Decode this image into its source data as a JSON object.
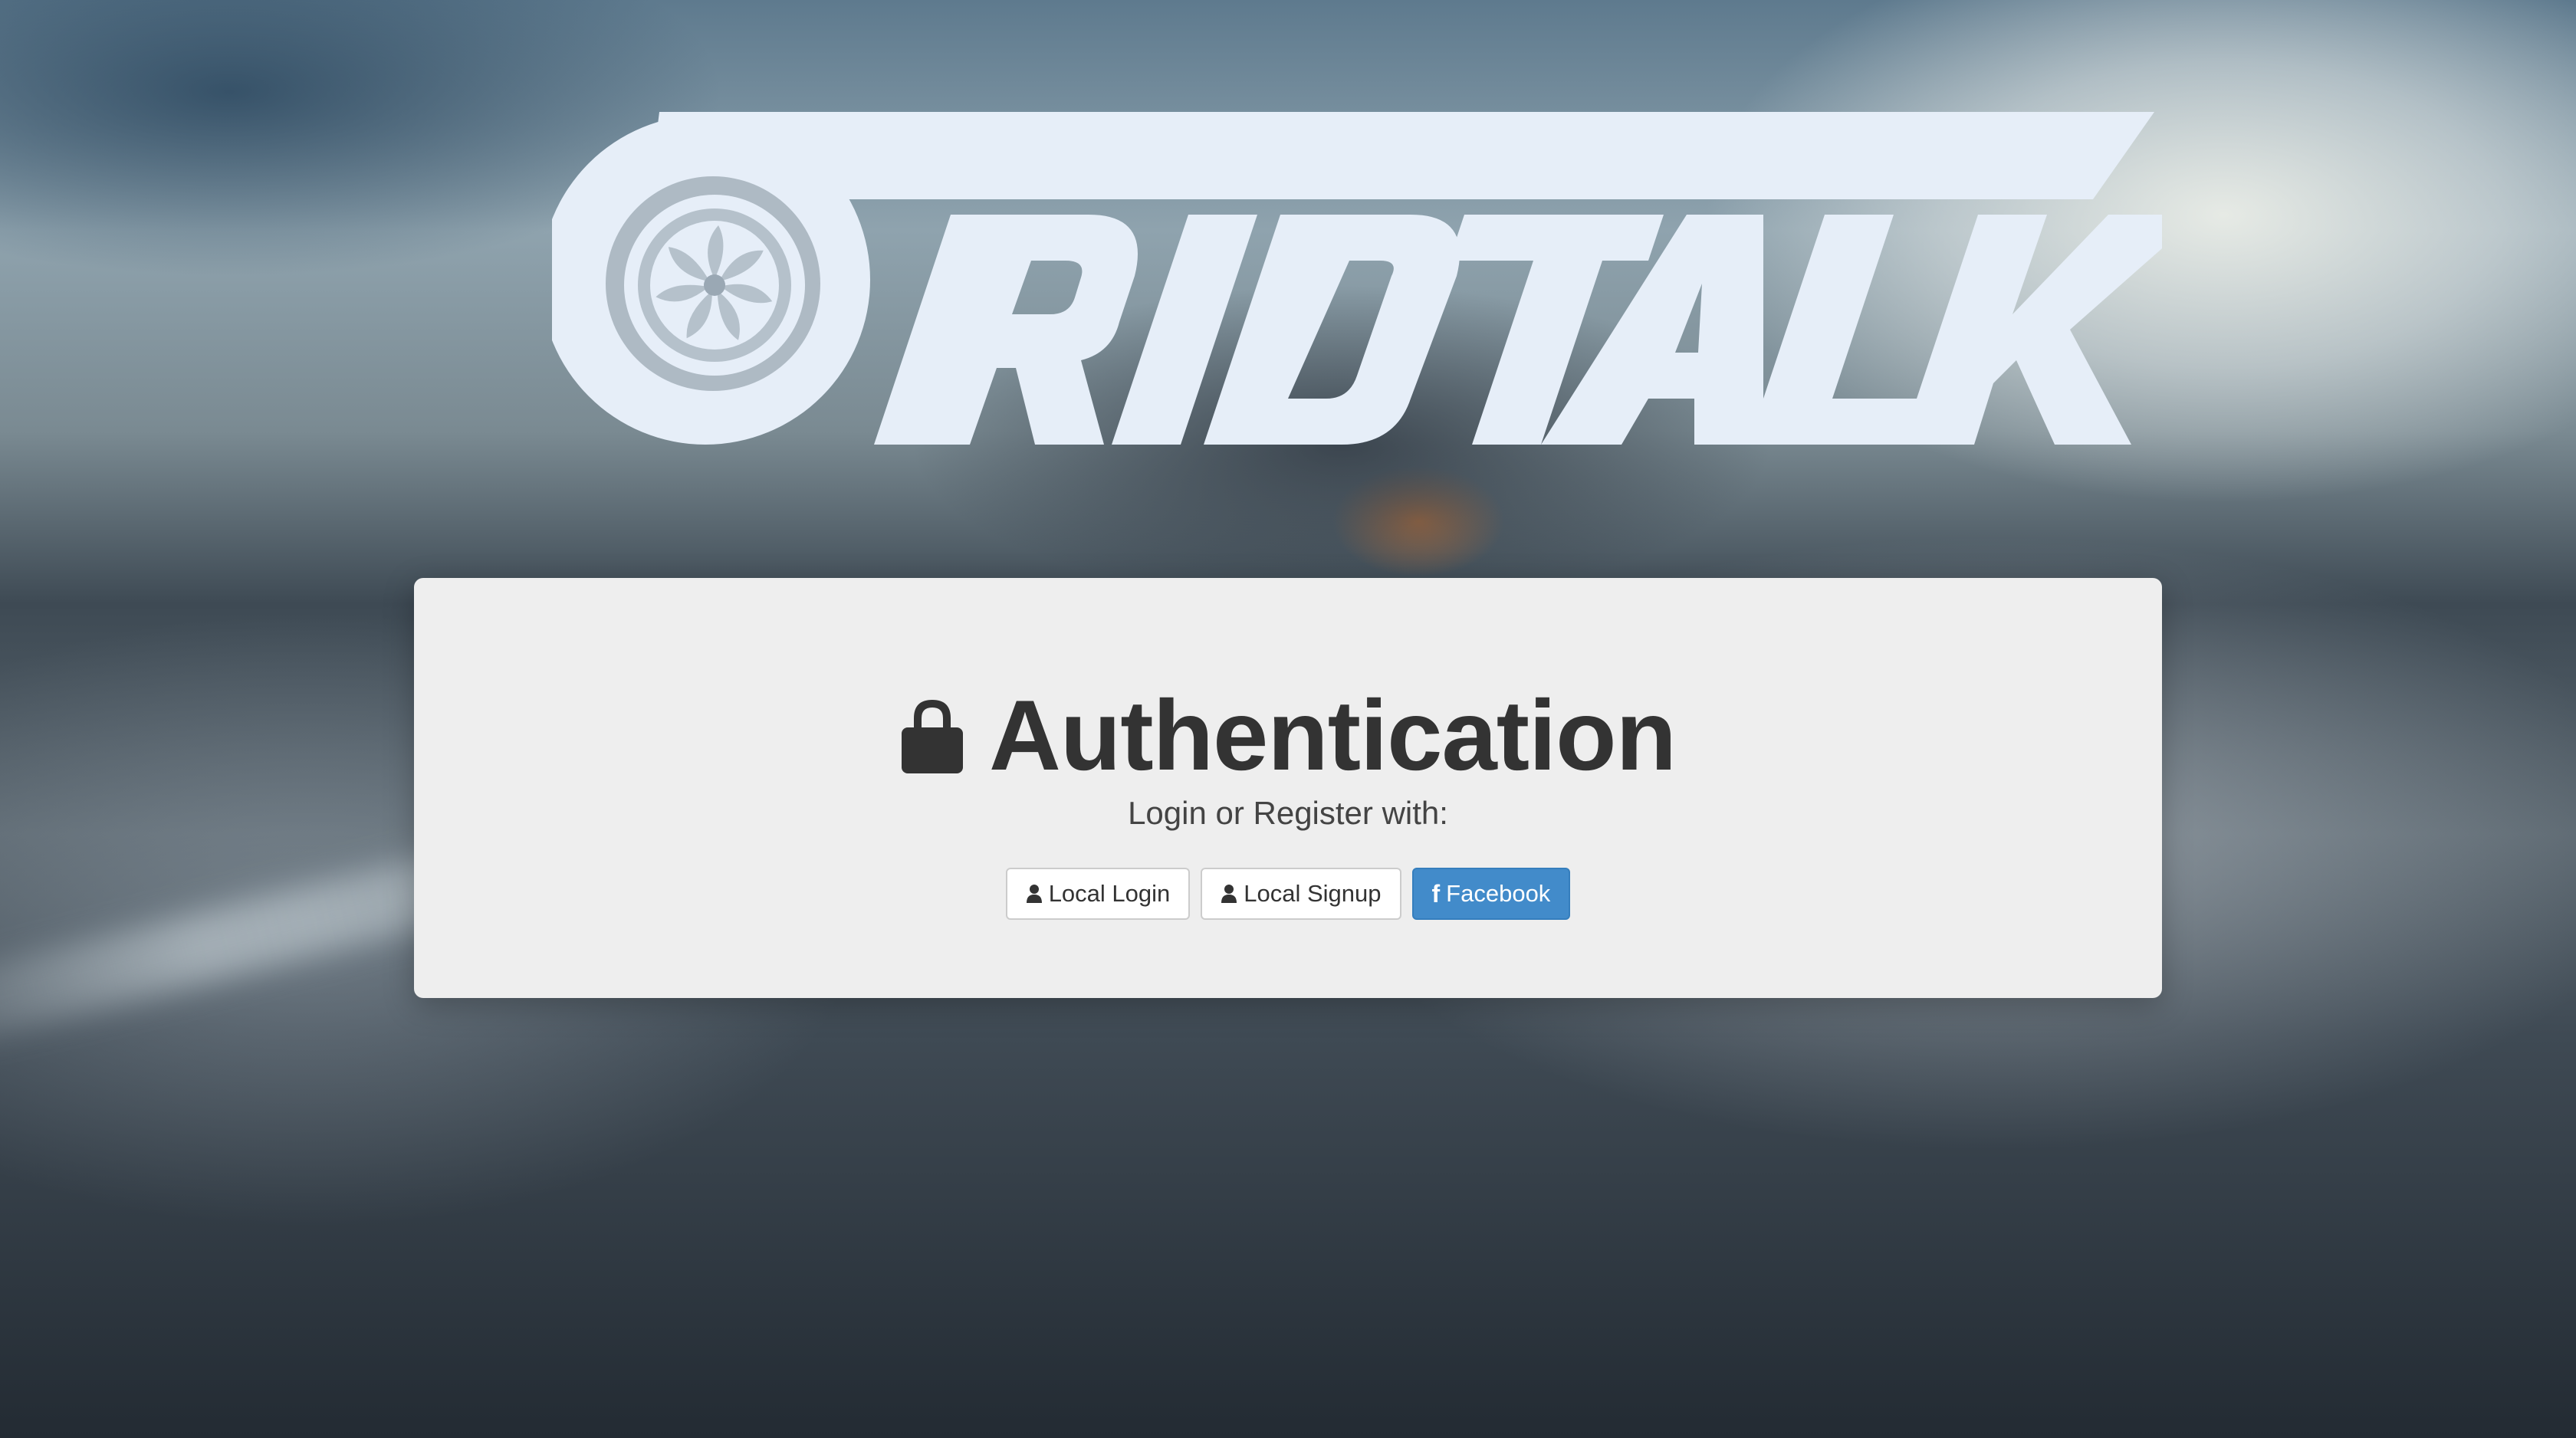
{
  "brand": {
    "logo_text": "GRIDTALK",
    "logo_color": "#e6eef8"
  },
  "auth": {
    "title": "Authentication",
    "subtitle": "Login or Register with:",
    "lock_icon": "lock-icon"
  },
  "buttons": {
    "local_login": {
      "label": "Local Login",
      "icon": "user-icon"
    },
    "local_signup": {
      "label": "Local Signup",
      "icon": "user-icon"
    },
    "facebook": {
      "label": "Facebook",
      "icon": "facebook-icon",
      "icon_glyph": "f",
      "color": "#428bca"
    }
  },
  "colors": {
    "panel_bg": "#eeeeee",
    "text_dark": "#333333"
  }
}
